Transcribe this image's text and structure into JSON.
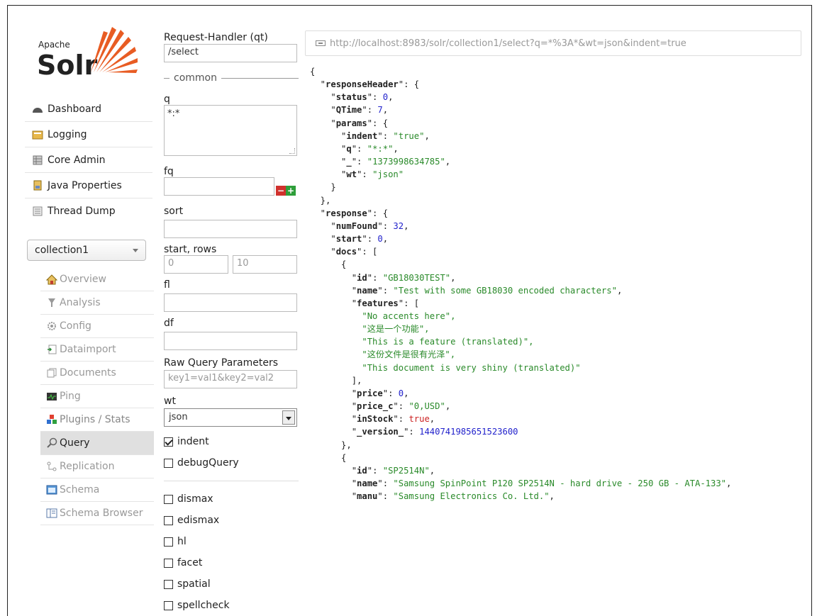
{
  "logo": {
    "apache": "Apache",
    "solr": "Solr"
  },
  "nav": {
    "items": [
      {
        "label": "Dashboard",
        "icon": "dashboard-icon"
      },
      {
        "label": "Logging",
        "icon": "logging-icon"
      },
      {
        "label": "Core Admin",
        "icon": "core-admin-icon"
      },
      {
        "label": "Java Properties",
        "icon": "java-properties-icon"
      },
      {
        "label": "Thread Dump",
        "icon": "thread-dump-icon"
      }
    ]
  },
  "core_selector": {
    "value": "collection1"
  },
  "core_nav": {
    "items": [
      {
        "label": "Overview",
        "icon": "home-icon"
      },
      {
        "label": "Analysis",
        "icon": "filter-icon"
      },
      {
        "label": "Config",
        "icon": "gear-icon"
      },
      {
        "label": "Dataimport",
        "icon": "dataimport-icon"
      },
      {
        "label": "Documents",
        "icon": "documents-icon"
      },
      {
        "label": "Ping",
        "icon": "ping-icon"
      },
      {
        "label": "Plugins / Stats",
        "icon": "plugins-icon"
      },
      {
        "label": "Query",
        "icon": "search-icon"
      },
      {
        "label": "Replication",
        "icon": "replication-icon"
      },
      {
        "label": "Schema",
        "icon": "schema-icon"
      },
      {
        "label": "Schema Browser",
        "icon": "schema-browser-icon"
      }
    ]
  },
  "form": {
    "handler_label": "Request-Handler (qt)",
    "handler_value": "/select",
    "common_legend": "common",
    "q_label": "q",
    "q_value": "*:*",
    "fq_label": "fq",
    "fq_value": "",
    "sort_label": "sort",
    "sort_value": "",
    "start_rows_label": "start, rows",
    "start_value": "0",
    "rows_value": "10",
    "fl_label": "fl",
    "fl_value": "",
    "df_label": "df",
    "df_value": "",
    "raw_label": "Raw Query Parameters",
    "raw_placeholder": "key1=val1&key2=val2",
    "wt_label": "wt",
    "wt_value": "json",
    "indent_label": "indent",
    "debug_label": "debugQuery",
    "dismax_label": "dismax",
    "edismax_label": "edismax",
    "hl_label": "hl",
    "facet_label": "facet",
    "spatial_label": "spatial",
    "spellcheck_label": "spellcheck"
  },
  "result": {
    "url": "http://localhost:8983/solr/collection1/select?q=*%3A*&wt=json&indent=true",
    "response_header": {
      "status": "0",
      "qtime": "7",
      "indent": "\"true\"",
      "q": "\"*:*\"",
      "underscore": "\"1373998634785\"",
      "wt": "\"json\""
    },
    "response": {
      "numFound": "32",
      "start": "0"
    },
    "doc1": {
      "id": "\"GB18030TEST\"",
      "name": "\"Test with some GB18030 encoded characters\"",
      "features": [
        "\"No accents here\",",
        "\"这是一个功能\",",
        "\"This is a feature (translated)\",",
        "\"这份文件是很有光泽\",",
        "\"This document is very shiny (translated)\""
      ],
      "price": "0",
      "price_c": "\"0,USD\"",
      "inStock": "true",
      "version": "1440741985651523600"
    },
    "doc2": {
      "id": "\"SP2514N\"",
      "name": "\"Samsung SpinPoint P120 SP2514N - hard drive - 250 GB - ATA-133\"",
      "manu": "\"Samsung Electronics Co. Ltd.\""
    }
  }
}
